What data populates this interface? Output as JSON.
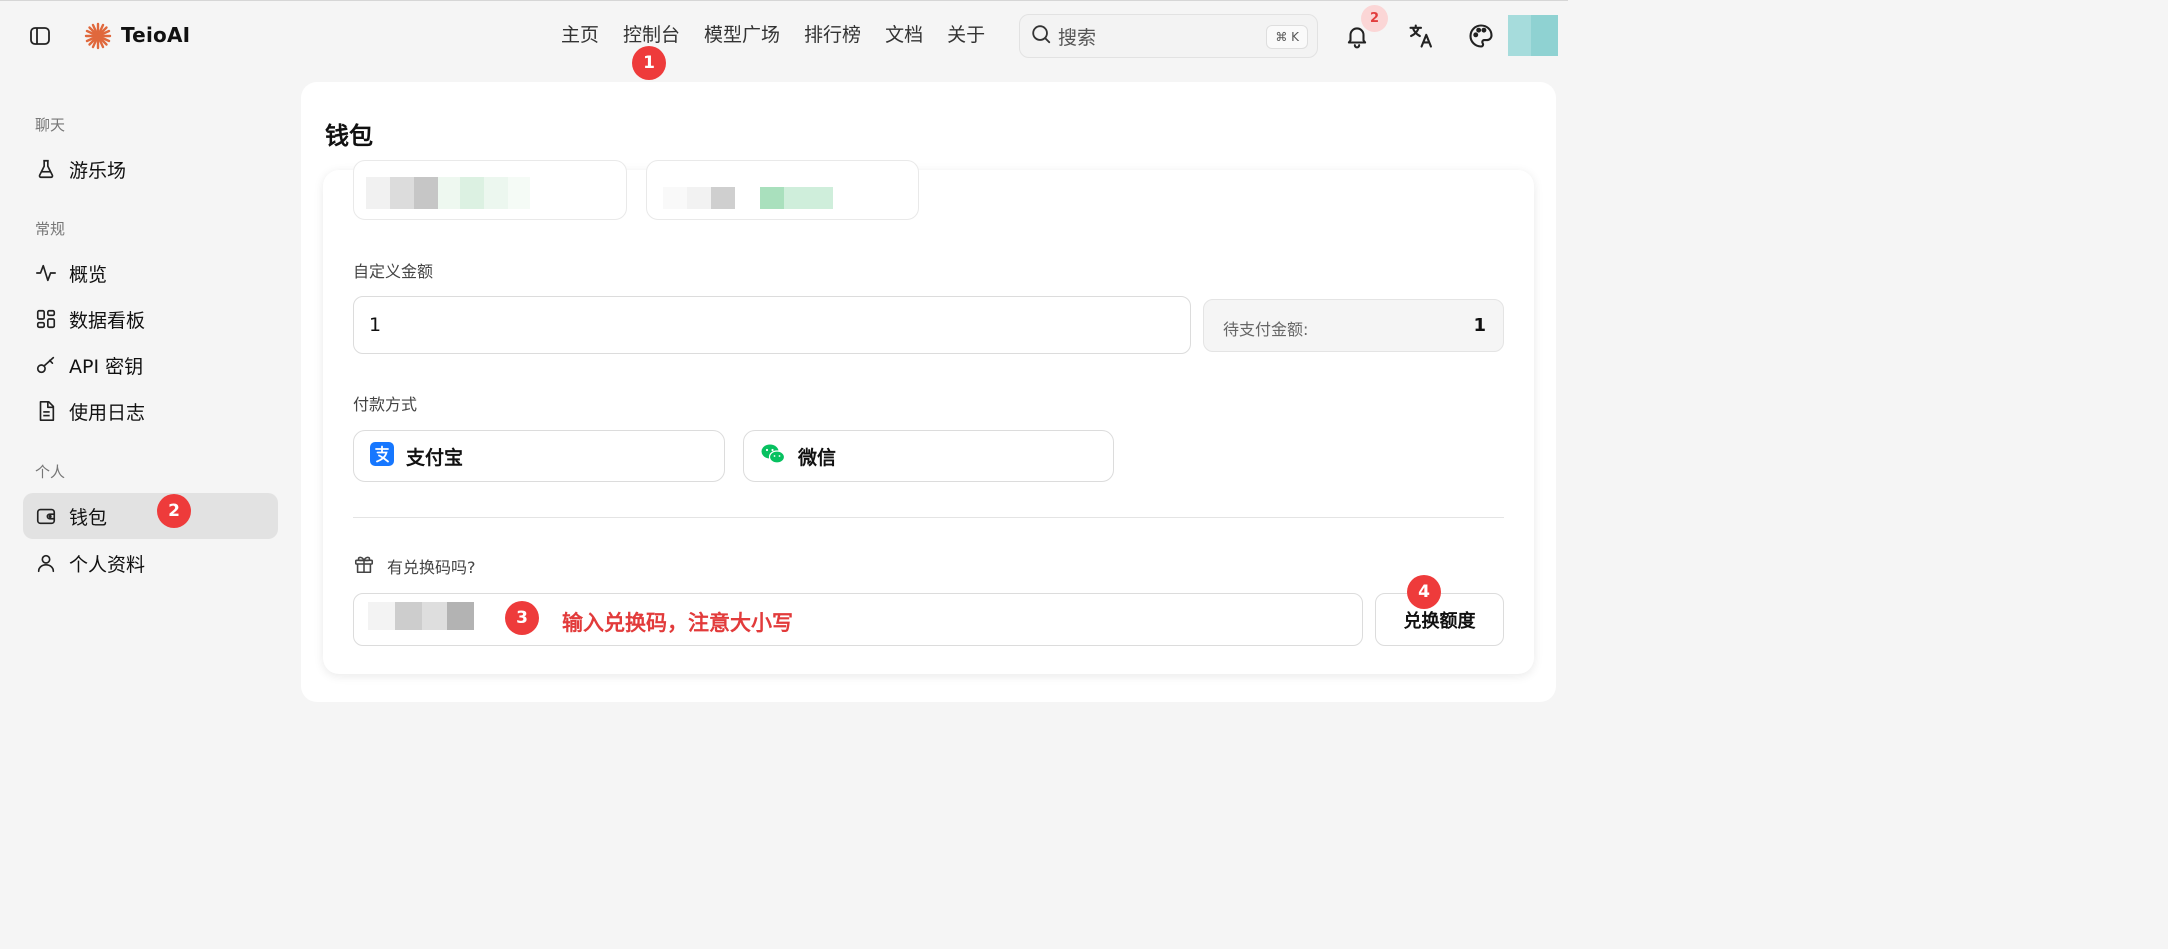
{
  "app": {
    "brand": "TeioAI"
  },
  "nav": [
    "主页",
    "控制台",
    "模型广场",
    "排行榜",
    "文档",
    "关于"
  ],
  "search": {
    "placeholder": "搜索",
    "shortcut": "⌘ K"
  },
  "notifications": {
    "count": "2"
  },
  "sidebar": {
    "sections": [
      {
        "title": "聊天",
        "items": [
          {
            "label": "游乐场",
            "icon": "flask-icon"
          }
        ]
      },
      {
        "title": "常规",
        "items": [
          {
            "label": "概览",
            "icon": "activity-icon"
          },
          {
            "label": "数据看板",
            "icon": "grid-icon"
          },
          {
            "label": "API 密钥",
            "icon": "key-icon"
          },
          {
            "label": "使用日志",
            "icon": "file-text-icon"
          }
        ]
      },
      {
        "title": "个人",
        "items": [
          {
            "label": "钱包",
            "icon": "wallet-icon",
            "active": true
          },
          {
            "label": "个人资料",
            "icon": "user-icon"
          }
        ]
      }
    ]
  },
  "wallet": {
    "title": "钱包",
    "custom_amount_label": "自定义金额",
    "custom_amount_value": "1",
    "payable_label": "待支付金额:",
    "payable_value": "1",
    "payment_method_label": "付款方式",
    "payment_methods": [
      {
        "label": "支付宝",
        "icon": "alipay-icon",
        "color": "#1677ff"
      },
      {
        "label": "微信",
        "icon": "wechat-icon",
        "color": "#07c160"
      }
    ],
    "redeem_question": "有兑换码吗?",
    "redeem_button": "兑换额度"
  },
  "annotations": {
    "markers": [
      "1",
      "2",
      "3",
      "4"
    ],
    "hint": "输入兑换码，注意大小写"
  },
  "colors": {
    "marker": "#ee3b3b",
    "hint_text": "#e23b3b",
    "active_item": "#e2e2e2"
  }
}
